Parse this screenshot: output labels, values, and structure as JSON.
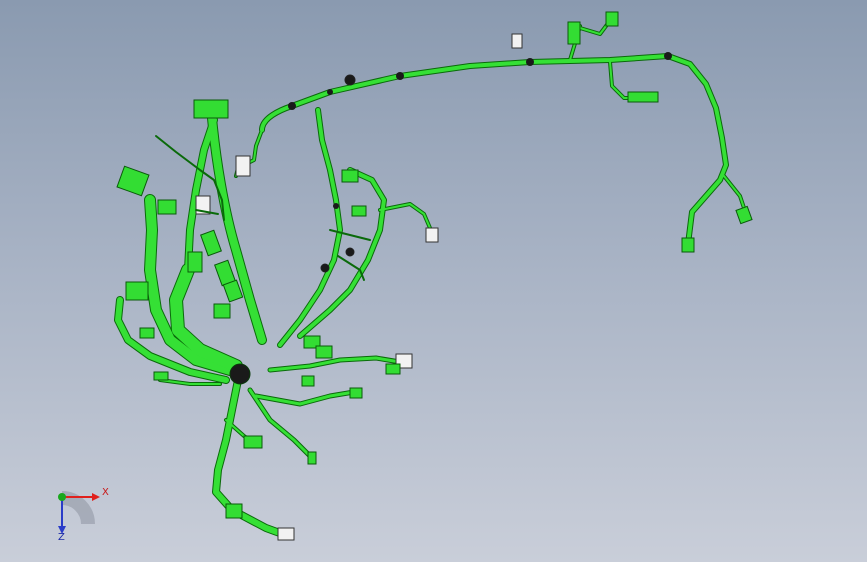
{
  "view": {
    "background_top": "#8a9ab0",
    "background_bottom": "#c9ced9",
    "model_color": "#33dd33",
    "model_edge_color": "#0a6a0a",
    "model_type": "wire-harness-assembly"
  },
  "triad": {
    "x_label": "X",
    "z_label": "Z",
    "x_color": "#e0201c",
    "y_color": "#18a81c",
    "z_color": "#2a3cc8"
  }
}
